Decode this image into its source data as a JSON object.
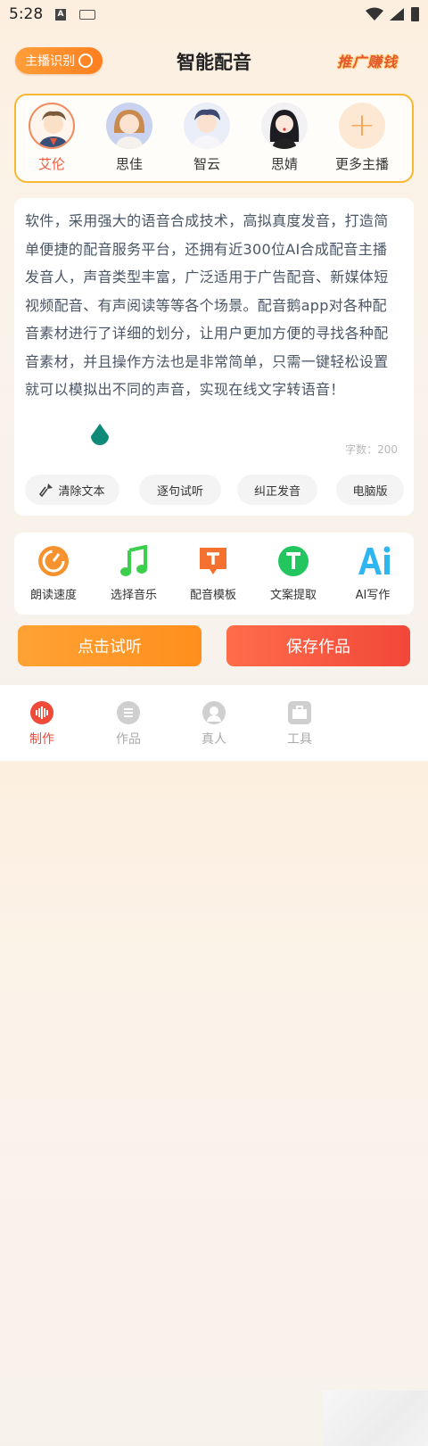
{
  "status": {
    "time": "5:28"
  },
  "header": {
    "host_id_label": "主播识别",
    "title": "智能配音",
    "promo_label": "推广赚钱"
  },
  "anchors": [
    {
      "name": "艾伦",
      "selected": true
    },
    {
      "name": "思佳",
      "selected": false
    },
    {
      "name": "智云",
      "selected": false
    },
    {
      "name": "思婧",
      "selected": false
    },
    {
      "name": "更多主播",
      "selected": false
    }
  ],
  "editor": {
    "text": "软件，采用强大的语音合成技术，高拟真度发音，打造简单便捷的配音服务平台，还拥有近300位AI合成配音主播发音人，声音类型丰富，广泛适用于广告配音、新媒体短视频配音、有声阅读等等各个场景。配音鹅app对各种配音素材进行了详细的划分，让用户更加方便的寻找各种配音素材，并且操作方法也是非常简单，只需一键轻松设置就可以模拟出不同的声音，实现在线文字转语音！",
    "char_count": "字数：200",
    "actions": [
      "清除文本",
      "逐句试听",
      "纠正发音",
      "电脑版"
    ]
  },
  "tools": [
    {
      "label": "朗读速度",
      "icon": "speedometer-icon",
      "color": "#f7932f"
    },
    {
      "label": "选择音乐",
      "icon": "music-note-icon",
      "color": "#3ccf4e"
    },
    {
      "label": "配音模板",
      "icon": "template-icon",
      "color": "#f5712f"
    },
    {
      "label": "文案提取",
      "icon": "text-extract-icon",
      "color": "#22c55e"
    },
    {
      "label": "AI写作",
      "icon": "ai-writing-icon",
      "color": "#2fb5f0"
    }
  ],
  "buttons": {
    "preview": "点击试听",
    "save": "保存作品"
  },
  "tabs": [
    {
      "label": "制作",
      "icon": "waveform-icon",
      "active": true
    },
    {
      "label": "作品",
      "icon": "list-icon",
      "active": false
    },
    {
      "label": "真人",
      "icon": "person-icon",
      "active": false
    },
    {
      "label": "工具",
      "icon": "toolbox-icon",
      "active": false
    }
  ],
  "colors": {
    "accent_orange": "#ff9f3a",
    "accent_red": "#ef4a3a",
    "panel_border": "#f7b733"
  }
}
